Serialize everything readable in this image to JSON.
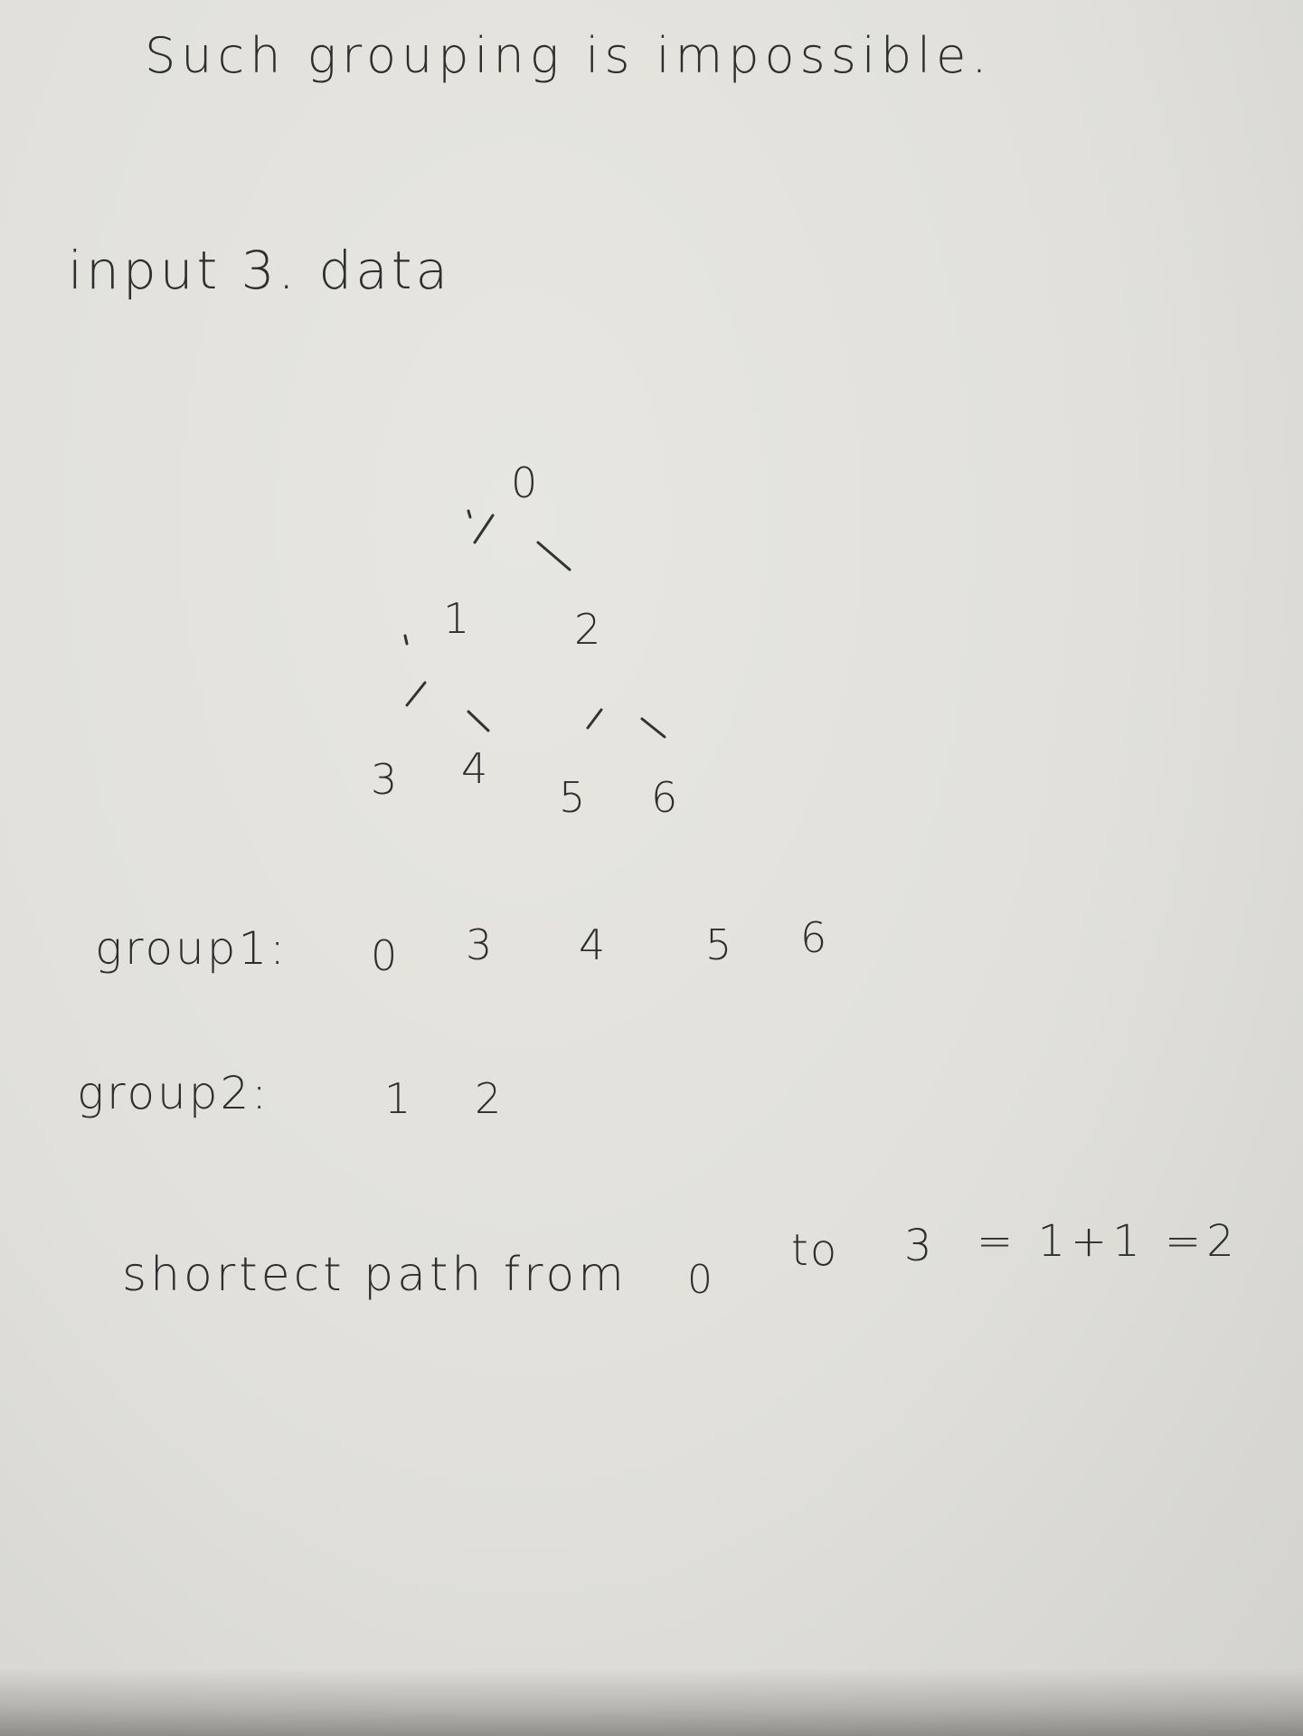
{
  "note": {
    "heading": "Such grouping is impossible.",
    "input_label": "input 3. data"
  },
  "tree": {
    "nodes": [
      "0",
      "1",
      "2",
      "3",
      "4",
      "5",
      "6"
    ],
    "edges": [
      [
        "0",
        "1"
      ],
      [
        "0",
        "2"
      ],
      [
        "1",
        "3"
      ],
      [
        "1",
        "4"
      ],
      [
        "2",
        "5"
      ],
      [
        "2",
        "6"
      ]
    ]
  },
  "groups": [
    {
      "label": "group1:",
      "members": [
        "0",
        "3",
        "4",
        "5",
        "6"
      ]
    },
    {
      "label": "group2:",
      "members": [
        "1",
        "2"
      ]
    }
  ],
  "path": {
    "label": "shortect path from",
    "from": "0",
    "to_word": "to",
    "target": "3",
    "expression": "= 1+1 =2"
  }
}
